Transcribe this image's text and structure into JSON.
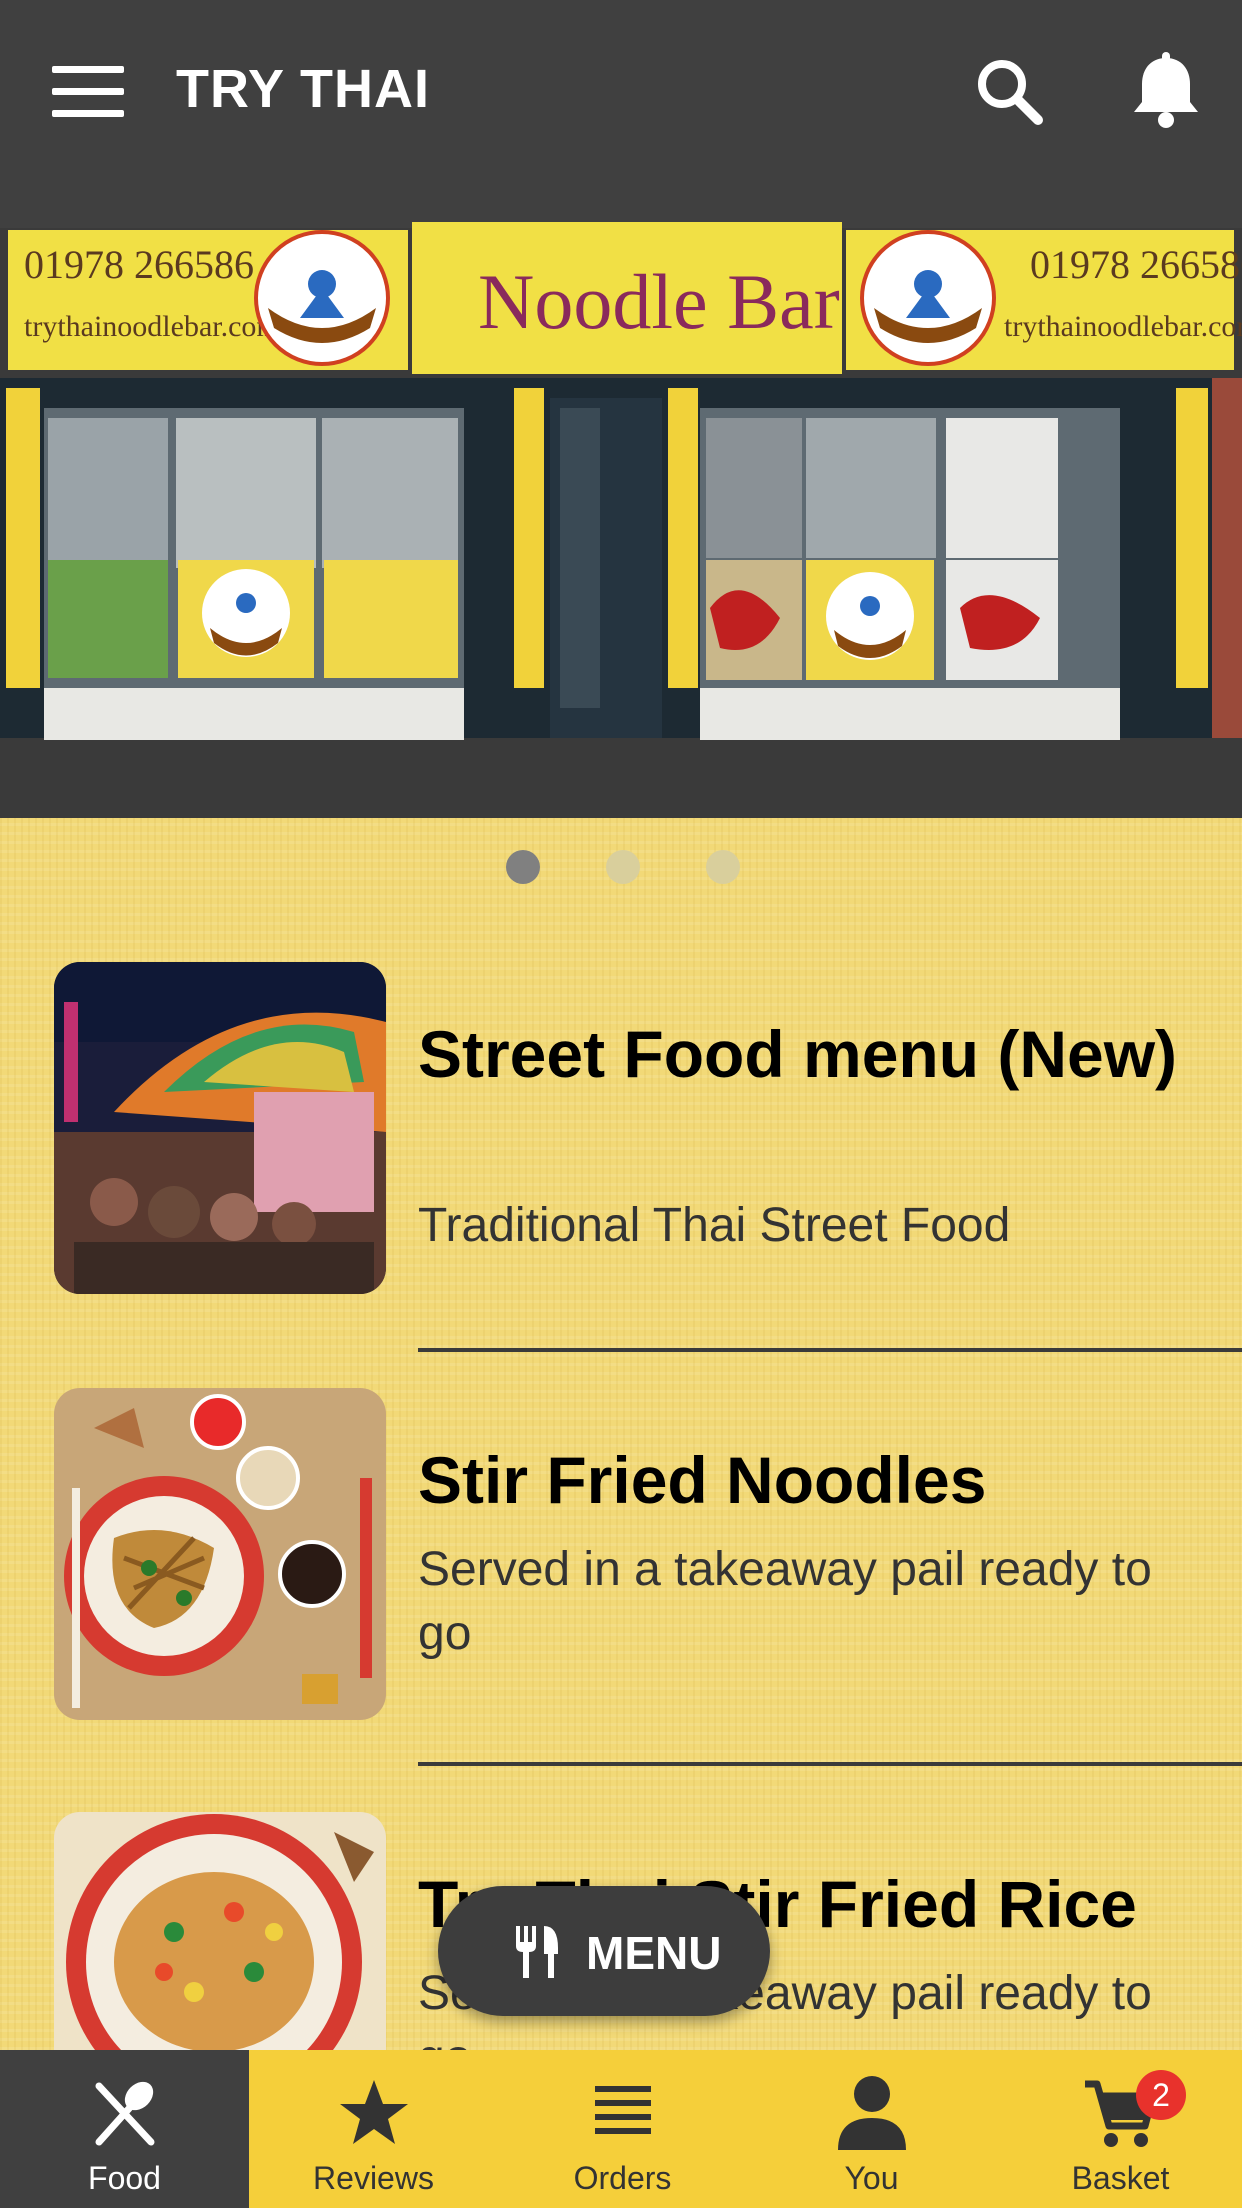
{
  "header": {
    "title": "TRY THAI",
    "menu_icon": "hamburger-icon",
    "search_icon": "search-icon",
    "notifications_icon": "bell-icon"
  },
  "hero": {
    "sign_phone": "01978 266586",
    "sign_web": "trythainoodlebar.com",
    "sign_name": "Noodle Bar",
    "sign_logo": "Try Thai Noodle Bar",
    "shop_poster": "Try Thai Shop",
    "carousel_total": 3,
    "carousel_active": 1
  },
  "menu_items": [
    {
      "title": "Street Food menu (New)",
      "description": "Traditional Thai Street Food"
    },
    {
      "title": "Stir Fried Noodles",
      "description": "Served in a takeaway pail ready to go"
    },
    {
      "title": "Try Thai Stir Fried Rice",
      "description": "Served in a takeaway pail ready to go"
    }
  ],
  "fab": {
    "label": "MENU",
    "icon": "utensils-icon"
  },
  "bottom_nav": [
    {
      "label": "Food",
      "icon": "fork-knife-icon",
      "active": true
    },
    {
      "label": "Reviews",
      "icon": "star-icon"
    },
    {
      "label": "Orders",
      "icon": "list-icon"
    },
    {
      "label": "You",
      "icon": "person-icon"
    },
    {
      "label": "Basket",
      "icon": "cart-icon",
      "badge": "2"
    }
  ],
  "colors": {
    "header_bg": "#404040",
    "content_bg": "#f2d977",
    "nav_bg": "#f5cf3a",
    "badge": "#e8322c"
  }
}
